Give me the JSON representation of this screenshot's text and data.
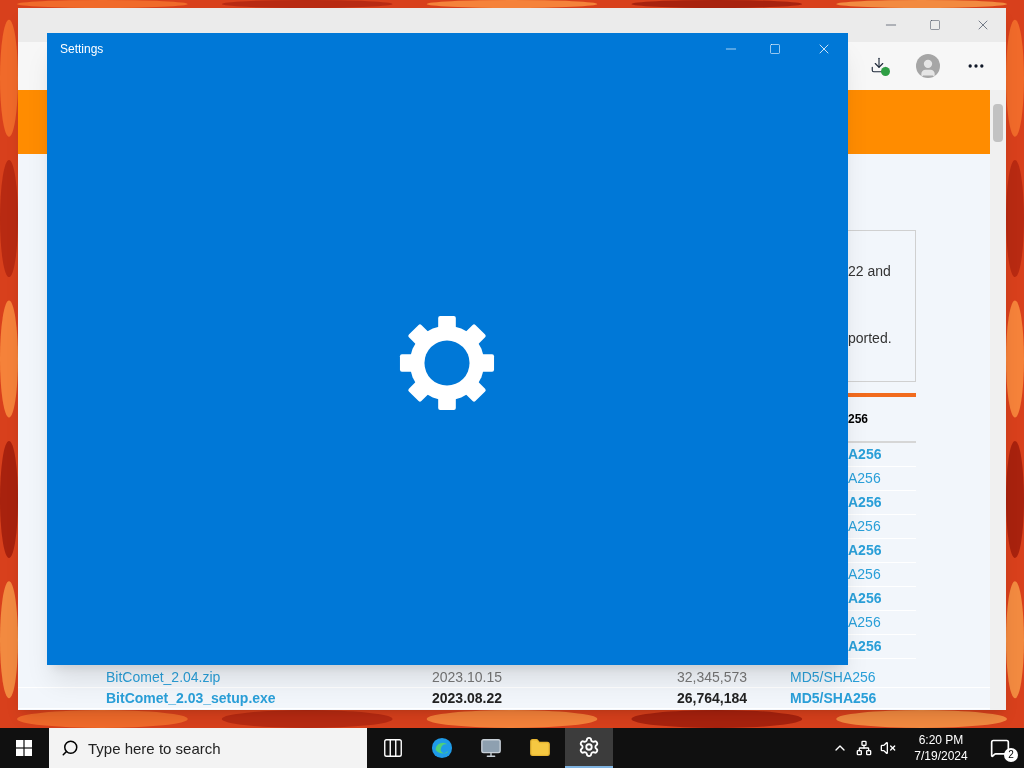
{
  "browser": {
    "banner": {
      "kind": "orange"
    },
    "notice": [
      "22 and",
      "ported."
    ],
    "table_header": "256",
    "partial_rows": [
      {
        "hash": "A256",
        "bold": true
      },
      {
        "hash": "A256",
        "bold": false
      },
      {
        "hash": "A256",
        "bold": true
      },
      {
        "hash": "A256",
        "bold": false
      },
      {
        "hash": "A256",
        "bold": true
      },
      {
        "hash": "A256",
        "bold": false
      },
      {
        "hash": "A256",
        "bold": true
      },
      {
        "hash": "A256",
        "bold": false
      },
      {
        "hash": "A256",
        "bold": true
      }
    ],
    "rows": [
      {
        "name": "BitComet_2.04.zip",
        "date": "2023.10.15",
        "size": "32,345,573",
        "hash": "MD5/SHA256",
        "bold": false
      },
      {
        "name": "BitComet_2.03_setup.exe",
        "date": "2023.08.22",
        "size": "26,764,184",
        "hash": "MD5/SHA256",
        "bold": true
      }
    ]
  },
  "settings_window": {
    "title": "Settings"
  },
  "taskbar": {
    "search": {
      "placeholder": "Type here to search"
    },
    "apps": [
      {
        "kind": "taskview",
        "selected": false
      },
      {
        "kind": "edge",
        "selected": false
      },
      {
        "kind": "monitor",
        "selected": false
      },
      {
        "kind": "folder",
        "selected": false
      },
      {
        "kind": "settings",
        "selected": true
      }
    ],
    "time": "6:20 PM",
    "date": "7/19/2024",
    "notifications": "2"
  }
}
